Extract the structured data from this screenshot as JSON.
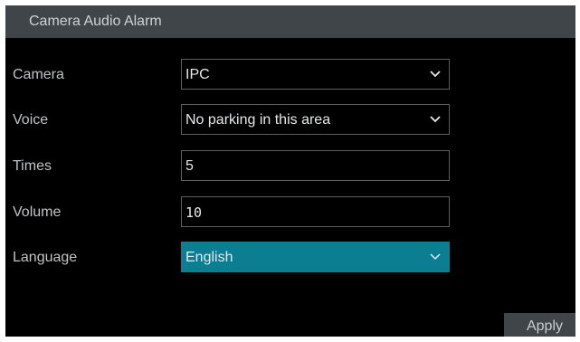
{
  "dialog": {
    "title": "Camera Audio Alarm",
    "fields": [
      {
        "label": "Camera",
        "value": "IPC",
        "type": "dropdown"
      },
      {
        "label": "Voice",
        "value": "No parking in this area",
        "type": "dropdown"
      },
      {
        "label": "Times",
        "value": "5",
        "type": "text"
      },
      {
        "label": "Volume",
        "value": "10",
        "type": "text"
      },
      {
        "label": "Language",
        "value": "English",
        "type": "dropdown",
        "state": "focused"
      }
    ],
    "apply_label": "Apply"
  },
  "colors": {
    "background": "#000000",
    "title_bar": "#3f4548",
    "field_border": "#5a5f62",
    "accent": "#0b7e92"
  },
  "icons": {
    "dropdown": "chevron-down-icon"
  }
}
